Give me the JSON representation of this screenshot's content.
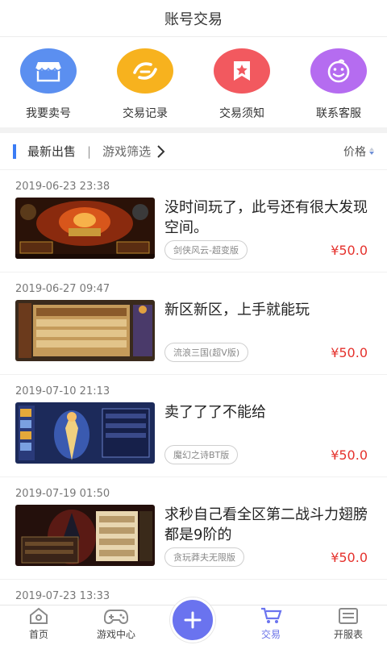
{
  "header": {
    "title": "账号交易"
  },
  "quick_actions": [
    {
      "label": "我要卖号",
      "icon": "store-icon",
      "color": "#5b8ff0"
    },
    {
      "label": "交易记录",
      "icon": "exchange-icon",
      "color": "#f7b21e"
    },
    {
      "label": "交易须知",
      "icon": "star-badge-icon",
      "color": "#f2595f"
    },
    {
      "label": "联系客服",
      "icon": "smiley-icon",
      "color": "#b56cf0"
    }
  ],
  "filter": {
    "latest_label": "最新出售",
    "divider": "|",
    "game_filter_label": "游戏筛选",
    "price_sort_label": "价格"
  },
  "listings": [
    {
      "time": "2019-06-23 23:38",
      "title": "没时间玩了，此号还有很大发现空间。",
      "game": "剑侠风云-超变版",
      "price": "¥50.0"
    },
    {
      "time": "2019-06-27 09:47",
      "title": "新区新区，上手就能玩",
      "game": "流浪三国(超V版)",
      "price": "¥50.0"
    },
    {
      "time": "2019-07-10 21:13",
      "title": "卖了了了不能给",
      "game": "魔幻之诗BT版",
      "price": "¥50.0"
    },
    {
      "time": "2019-07-19 01:50",
      "title": "求秒自己看全区第二战斗力翅膀都是9阶的",
      "game": "贪玩莽夫无限版",
      "price": "¥50.0"
    },
    {
      "time": "2019-07-23 13:33",
      "title": "",
      "game": "",
      "price": ""
    }
  ],
  "tabbar": {
    "tabs": [
      {
        "label": "首页",
        "icon": "home-icon"
      },
      {
        "label": "游戏中心",
        "icon": "gamepad-icon"
      },
      {
        "label": "",
        "icon": "plus-icon"
      },
      {
        "label": "交易",
        "icon": "cart-icon"
      },
      {
        "label": "开服表",
        "icon": "calendar-icon"
      }
    ],
    "active_index": 3,
    "accent": "#6a73ef"
  }
}
